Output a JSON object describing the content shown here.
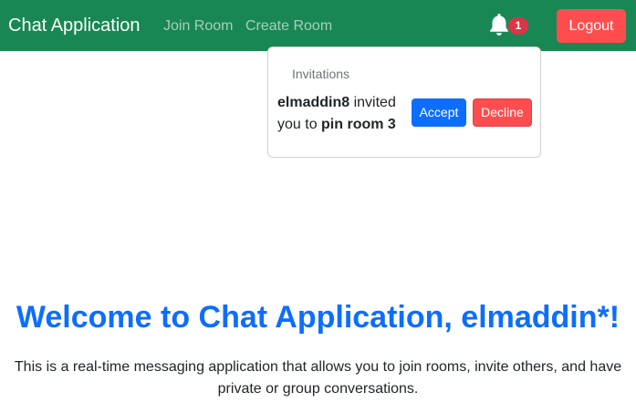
{
  "navbar": {
    "brand": "Chat Application",
    "links": [
      "Join Room",
      "Create Room"
    ],
    "notification_count": "1",
    "logout_label": "Logout",
    "bell_icon": "bell-icon",
    "colors": {
      "navbar": "#198754",
      "badge": "#dc3545",
      "logout": "#ff4d4f"
    }
  },
  "invitations": {
    "header": "Invitations",
    "items": [
      {
        "inviter": "elmaddin8",
        "text_mid": " invited you to ",
        "room": "pin room 3",
        "accept_label": "Accept",
        "decline_label": "Decline"
      }
    ]
  },
  "main": {
    "welcome": "Welcome to Chat Application, elmaddin*!",
    "description": "This is a real-time messaging application that allows you to join rooms, invite others, and have private or group conversations.",
    "accent_color": "#0d6efd"
  }
}
